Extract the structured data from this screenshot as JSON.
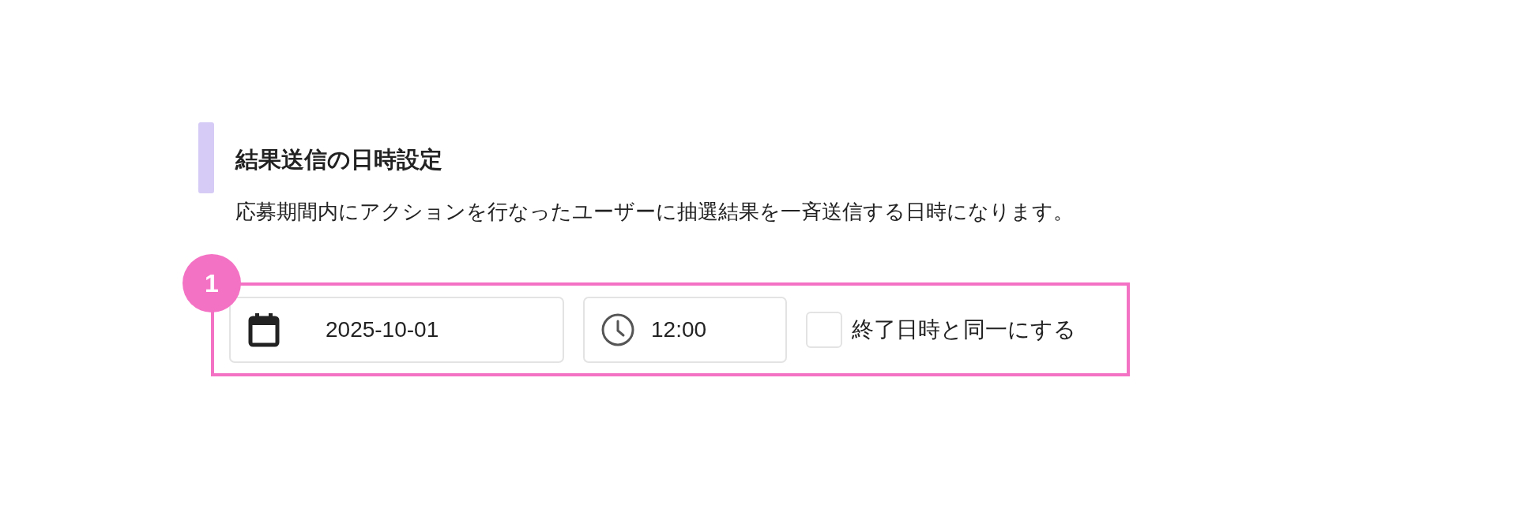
{
  "section": {
    "title": "結果送信の日時設定",
    "description": "応募期間内にアクションを行なったユーザーに抽選結果を一斉送信する日時になります。"
  },
  "badge": "1",
  "date_field": {
    "value": "2025-10-01"
  },
  "time_field": {
    "value": "12:00"
  },
  "same_as_end": {
    "label": "終了日時と同一にする",
    "checked": false
  }
}
